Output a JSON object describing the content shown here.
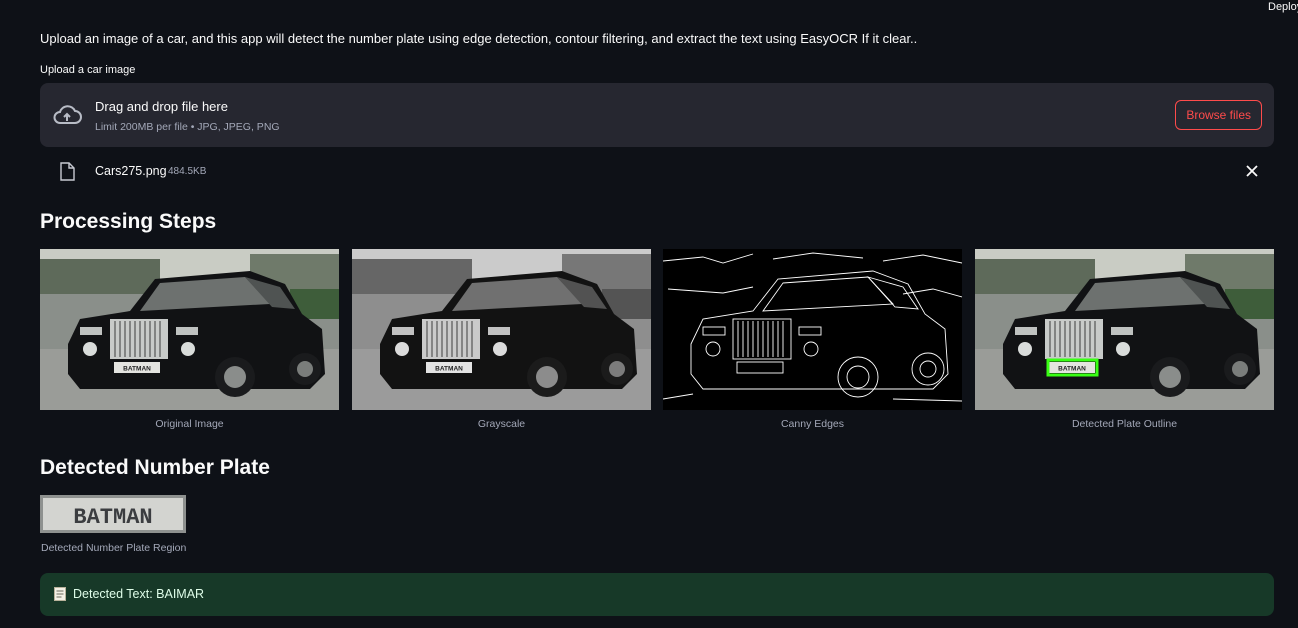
{
  "header": {
    "deploy_label": "Deploy"
  },
  "intro_text": "Upload an image of a car, and this app will detect the number plate using edge detection, contour filtering, and extract the text using EasyOCR If it clear..",
  "uploader": {
    "label": "Upload a car image",
    "drop_title": "Drag and drop file here",
    "limit_text": "Limit 200MB per file • JPG, JPEG, PNG",
    "browse_label": "Browse files",
    "icon": "cloud-upload-icon"
  },
  "uploaded_file": {
    "name": "Cars275.png",
    "size": "484.5KB",
    "icon": "file-icon"
  },
  "processing": {
    "title": "Processing Steps",
    "images": [
      {
        "caption": "Original Image",
        "plate_text": "BATMAN"
      },
      {
        "caption": "Grayscale",
        "plate_text": "BATMAN"
      },
      {
        "caption": "Canny Edges"
      },
      {
        "caption": "Detected Plate Outline",
        "plate_text": "BATMAN"
      }
    ]
  },
  "detected_plate": {
    "title": "Detected Number Plate",
    "plate_text": "BATMAN",
    "caption": "Detected Number Plate Region"
  },
  "result": {
    "icon": "memo-icon",
    "text": "Detected Text: BAIMAR"
  },
  "colors": {
    "background": "#0e1117",
    "panel": "#262730",
    "accent": "#ff4b4b",
    "success_bg": "#173928",
    "outline_green": "#39ff14"
  }
}
